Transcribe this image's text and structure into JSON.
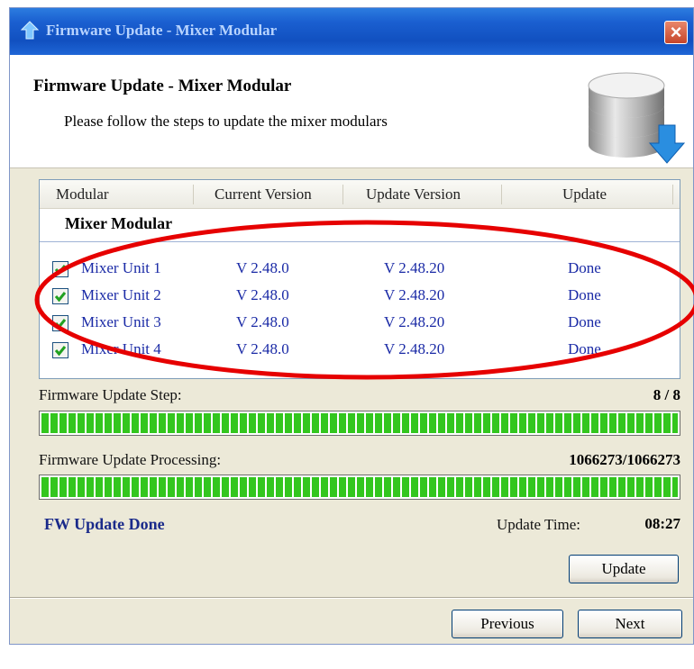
{
  "window": {
    "title": "Firmware Update - Mixer Modular",
    "close_icon": "close-icon"
  },
  "header": {
    "title": "Firmware Update - Mixer Modular",
    "subtitle": "Please follow the steps to update the mixer modulars",
    "icon": "database-download-icon"
  },
  "table": {
    "columns": [
      "Modular",
      "Current Version",
      "Update Version",
      "Update"
    ],
    "group": "Mixer Modular",
    "rows": [
      {
        "checked": true,
        "name": "Mixer Unit 1",
        "current": "V 2.48.0",
        "update": "V 2.48.20",
        "status": "Done"
      },
      {
        "checked": true,
        "name": "Mixer Unit 2",
        "current": "V 2.48.0",
        "update": "V 2.48.20",
        "status": "Done"
      },
      {
        "checked": true,
        "name": "Mixer Unit 3",
        "current": "V 2.48.0",
        "update": "V 2.48.20",
        "status": "Done"
      },
      {
        "checked": true,
        "name": "Mixer Unit 4",
        "current": "V 2.48.0",
        "update": "V 2.48.20",
        "status": "Done"
      }
    ]
  },
  "progress": {
    "step_label": "Firmware Update Step:",
    "step_value": "8 / 8",
    "step_fraction": 1.0,
    "processing_label": "Firmware Update Processing:",
    "processing_value": "1066273/1066273",
    "processing_fraction": 1.0,
    "status_text": "FW Update Done",
    "time_label": "Update Time:",
    "time_value": "08:27"
  },
  "buttons": {
    "update": "Update",
    "previous": "Previous",
    "next": "Next"
  },
  "colors": {
    "progress_fill": "#33c61e",
    "highlight_ellipse": "#e60000",
    "status_text": "#1a2a8a",
    "table_text": "#1a2aa6"
  }
}
